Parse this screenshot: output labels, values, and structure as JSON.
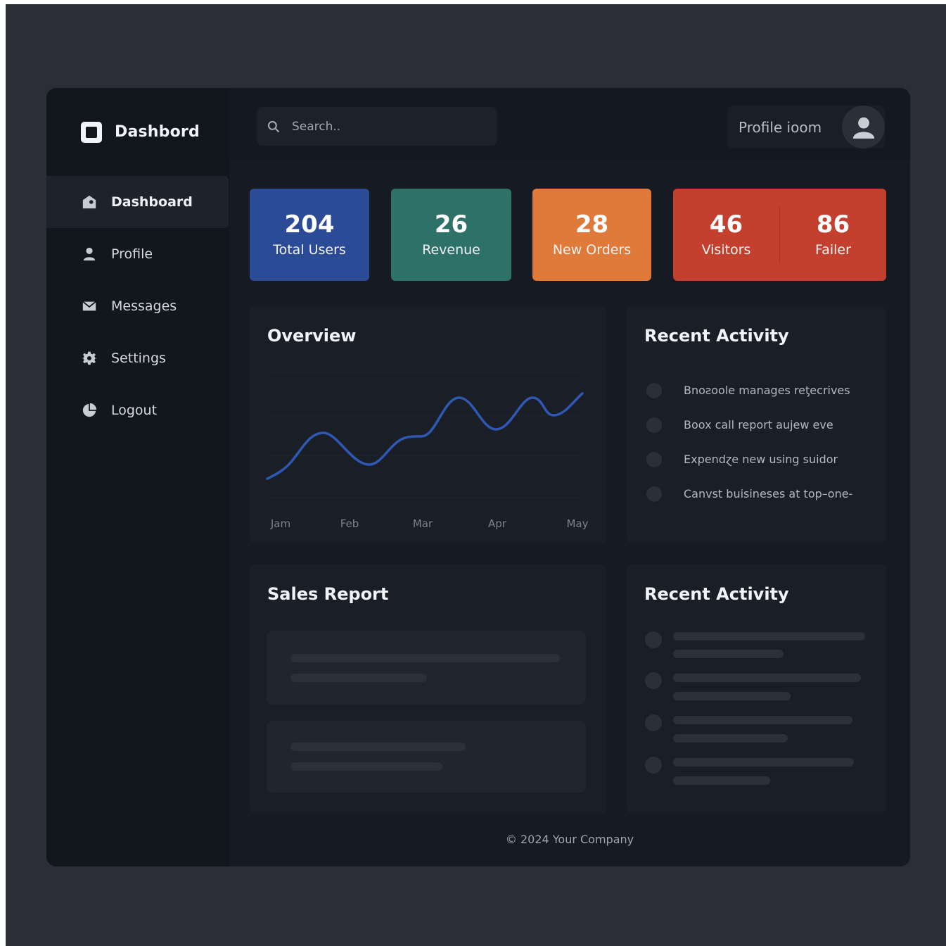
{
  "brand": {
    "title": "Dashbord",
    "icon": "square-logo-icon"
  },
  "sidebar": {
    "items": [
      {
        "label": "Dashboard",
        "icon": "home-icon",
        "active": true
      },
      {
        "label": "Profile",
        "icon": "user-icon",
        "active": false
      },
      {
        "label": "Messages",
        "icon": "envelope-icon",
        "active": false
      },
      {
        "label": "Settings",
        "icon": "gear-icon",
        "active": false
      },
      {
        "label": "Logout",
        "icon": "pie-icon",
        "active": false
      }
    ]
  },
  "search": {
    "placeholder": "Search.."
  },
  "profile": {
    "name": "Profile ioom"
  },
  "stats": [
    {
      "value": "204",
      "label": "Total Users",
      "color": "#2b4b97"
    },
    {
      "value": "26",
      "label": "Revenue",
      "color": "#2e7169"
    },
    {
      "value": "28",
      "label": "New Orders",
      "color": "#e07a3a"
    },
    {
      "value": "46",
      "label": "Visitors",
      "color": "#c3402f"
    },
    {
      "value": "86",
      "label": "Failer",
      "color": "#c3402f"
    }
  ],
  "overview": {
    "title": "Overview",
    "months": [
      "Jam",
      "Feb",
      "Mar",
      "Apr",
      "May"
    ]
  },
  "activity": {
    "title": "Recent Activity",
    "items": [
      "Bnoƨoole manages reƫecrives",
      "Boox call report aujew eve",
      "Expendɀe new using suidor",
      "Canvst buisineses at top–one-"
    ]
  },
  "sales": {
    "title": "Sales Report"
  },
  "activity2": {
    "title": "Recent Activity"
  },
  "footer": {
    "text": "© 2024 Your Company"
  },
  "colors": {
    "accent": "#2b4b97",
    "line": "#2f58b3"
  }
}
